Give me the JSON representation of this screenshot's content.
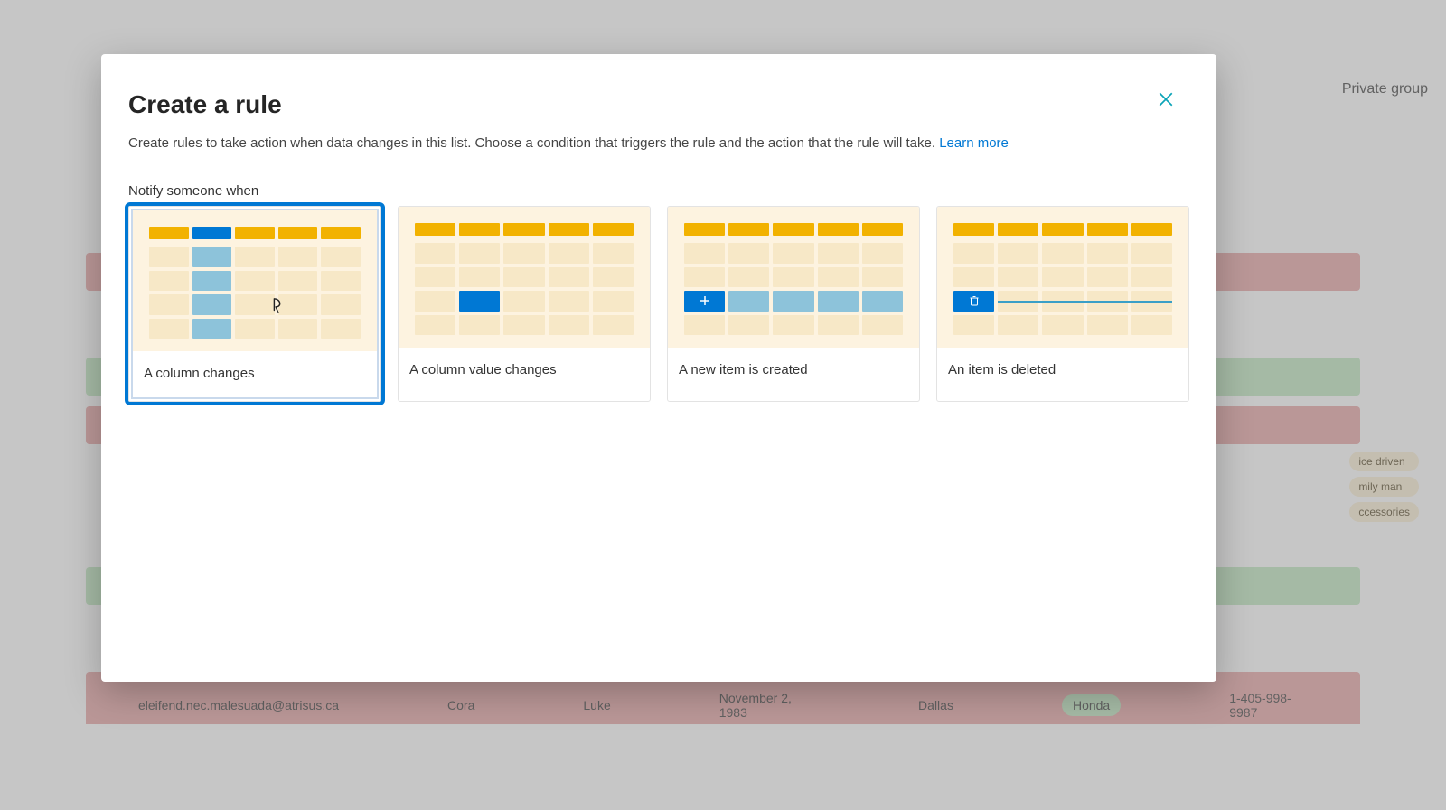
{
  "modal": {
    "title": "Create a rule",
    "description_text": "Create rules to take action when data changes in this list. Choose a condition that triggers the rule and the action that the rule will take. ",
    "learn_more": "Learn more",
    "section_label": "Notify someone when",
    "close_aria": "Close"
  },
  "cards": [
    {
      "label": "A column changes",
      "selected": true
    },
    {
      "label": "A column value changes",
      "selected": false
    },
    {
      "label": "A new item is created",
      "selected": false
    },
    {
      "label": "An item is deleted",
      "selected": false
    }
  ],
  "background": {
    "group_label": "Private group",
    "tags": [
      "ice driven",
      "mily man",
      "ccessories"
    ],
    "sample_row": {
      "email": "eleifend.nec.malesuada@atrisus.ca",
      "first": "Cora",
      "last": "Luke",
      "date": "November 2, 1983",
      "city": "Dallas",
      "car": "Honda",
      "phone": "1-405-998-9987"
    }
  }
}
